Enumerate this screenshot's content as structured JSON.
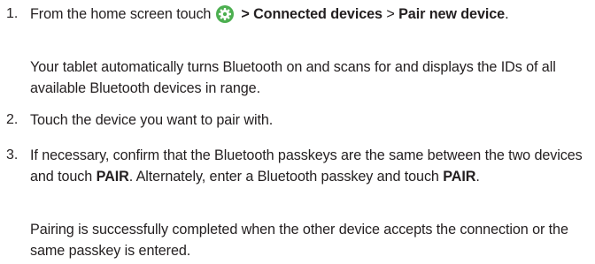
{
  "steps": [
    {
      "number": "1.",
      "text_before_icon": "From the home screen touch",
      "icon": "settings-gear-icon",
      "nav_1": "> Connected devices",
      "separator": " > ",
      "nav_2": "Pair new device",
      "end": ".",
      "note": "Your tablet automatically turns Bluetooth on and scans for and displays the IDs of all available Bluetooth devices in range."
    },
    {
      "number": "2.",
      "text": "Touch the device you want to pair with."
    },
    {
      "number": "3.",
      "text_a": "If necessary, confirm that the Bluetooth passkeys are the same between the two devices and touch ",
      "bold_a": "PAIR",
      "text_b": ". Alternately, enter a Bluetooth passkey and touch ",
      "bold_b": "PAIR",
      "end": ".",
      "note": "Pairing is successfully completed when the other device accepts the connection or the same passkey is entered."
    }
  ],
  "colors": {
    "text": "#231f20",
    "icon_fill": "#4caf50"
  }
}
